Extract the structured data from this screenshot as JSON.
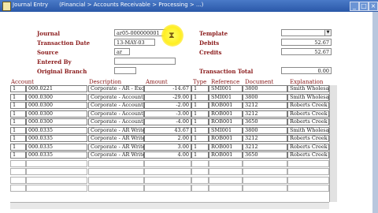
{
  "window": {
    "title": "Journal Entry",
    "path": "(Financial > Accounts Receivable > Processing > ...)",
    "minimize_glyph": "_",
    "maximize_glyph": "□",
    "close_glyph": "×"
  },
  "form": {
    "journal_label": "Journal",
    "journal_value": "ar05-000000001",
    "transaction_date_label": "Transaction Date",
    "transaction_date_value": "13-MAY-03",
    "source_label": "Source",
    "source_value": "ar",
    "entered_by_label": "Entered By",
    "entered_by_value": "",
    "original_branch_label": "Original Branch",
    "original_branch_value": "",
    "template_label": "Template",
    "template_value": "",
    "debits_label": "Debits",
    "debits_value": "52.67",
    "credits_label": "Credits",
    "credits_value": "52.67",
    "transaction_total_label": "Transaction Total",
    "transaction_total_value": "0.00"
  },
  "table": {
    "headers": [
      "Account",
      "Description",
      "Amount",
      "Type",
      "Reference",
      "Document",
      "Explanation"
    ],
    "rows": [
      [
        "1",
        "000.0221",
        "Corporate - AR - Exch",
        "-14.67",
        "1",
        "SMI001",
        "3800",
        "Smith Wholesal"
      ],
      [
        "1",
        "000.0300",
        "Corporate - Accounts R",
        "-29.00",
        "1",
        "SMI001",
        "3800",
        "Smith Wholesal"
      ],
      [
        "1",
        "000.0300",
        "Corporate - Accounts R",
        "-2.00",
        "1",
        "ROB001",
        "3212",
        "Roberts Creek Lu"
      ],
      [
        "1",
        "000.0300",
        "Corporate - Accounts R",
        "-3.00",
        "1",
        "ROB001",
        "3212",
        "Roberts Creek Lu"
      ],
      [
        "1",
        "000.0300",
        "Corporate - Accounts R",
        "-4.00",
        "1",
        "ROB001",
        "3650",
        "Roberts Creek Lu"
      ],
      [
        "1",
        "000.0335",
        "Corporate - AR Write-",
        "43.67",
        "1",
        "SMI001",
        "3800",
        "Smith Wholesal"
      ],
      [
        "1",
        "000.0335",
        "Corporate - AR Write-",
        "2.00",
        "1",
        "ROB001",
        "3212",
        "Roberts Creek Lu"
      ],
      [
        "1",
        "000.0335",
        "Corporate - AR Write-",
        "3.00",
        "1",
        "ROB001",
        "3212",
        "Roberts Creek Lu"
      ],
      [
        "1",
        "000.0335",
        "Corporate - AR Write-",
        "4.00",
        "1",
        "ROB001",
        "3650",
        "Roberts Creek Lu"
      ]
    ],
    "empty_rows": 4
  }
}
